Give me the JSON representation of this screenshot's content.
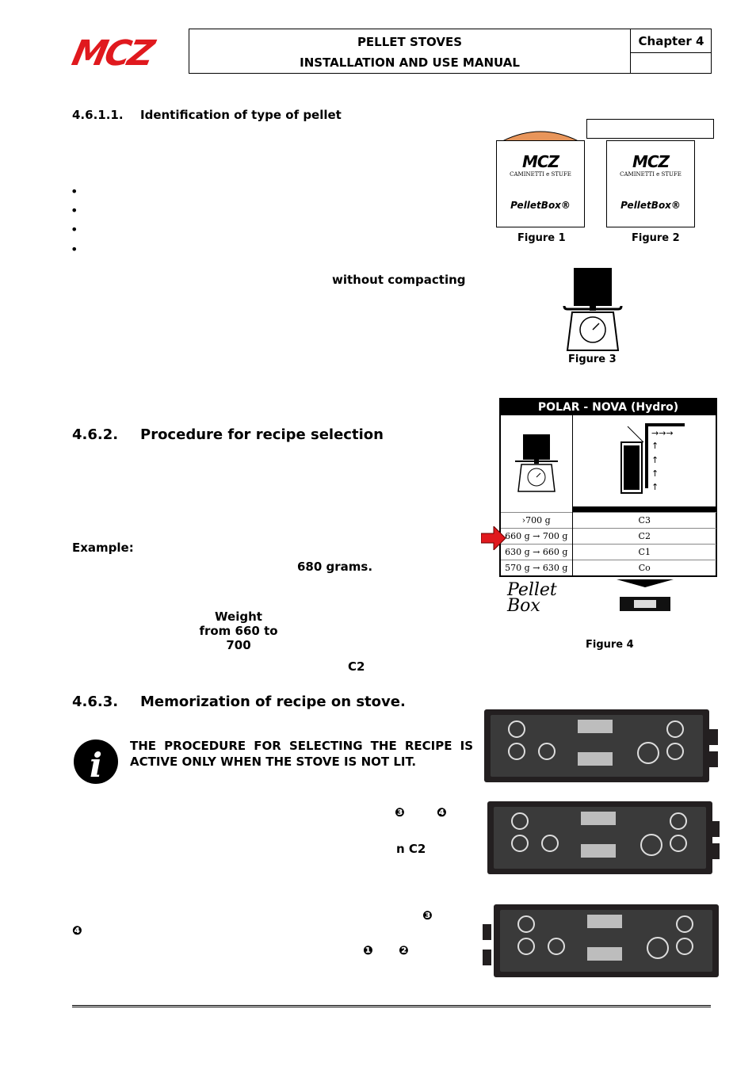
{
  "header": {
    "logo": "MCZ",
    "title_line1": "PELLET STOVES",
    "title_line2": "INSTALLATION AND USE MANUAL",
    "chapter": "Chapter 4"
  },
  "section_4611": {
    "number": "4.6.1.1.",
    "title": "Identification of type of pellet",
    "bullets": [
      "•",
      "•",
      "•",
      "•"
    ],
    "emphasis": "without  compacting"
  },
  "figures": {
    "fig1": "Figure 1",
    "fig2": "Figure 2",
    "fig3": "Figure 3",
    "fig4": "Figure 4",
    "box_logo": "MCZ",
    "box_sub": "CAMINETTI e STUFE",
    "box_name": "PelletBox®"
  },
  "recipe_table": {
    "title": "POLAR - NOVA (Hydro)",
    "rows": [
      {
        "weight": "›700 g",
        "recipe": "C3"
      },
      {
        "weight": "660 g → 700 g",
        "recipe": "C2"
      },
      {
        "weight": "630 g → 660 g",
        "recipe": "C1"
      },
      {
        "weight": "570 g → 630 g",
        "recipe": "Co"
      }
    ],
    "selected_row": 1,
    "arrow_color": "#e0191e",
    "pelletbox_label": "Pellet Box"
  },
  "section_462": {
    "number": "4.6.2.",
    "title": "Procedure for recipe selection",
    "example": "Example:",
    "grams": "680 grams.",
    "weight": "Weight",
    "range": "from 660 to 700",
    "recipe": "C2"
  },
  "section_463": {
    "number": "4.6.3.",
    "title": "Memorization of recipe on stove.",
    "notice": "THE  PROCEDURE  FOR  SELECTING  THE  RECIPE  IS ACTIVE ONLY WHEN THE STOVE IS NOT LIT.",
    "bullet3": "❸",
    "bullet4": "❹",
    "recipe_ref": "n  C2",
    "bullet1": "❶",
    "bullet2": "❷"
  }
}
